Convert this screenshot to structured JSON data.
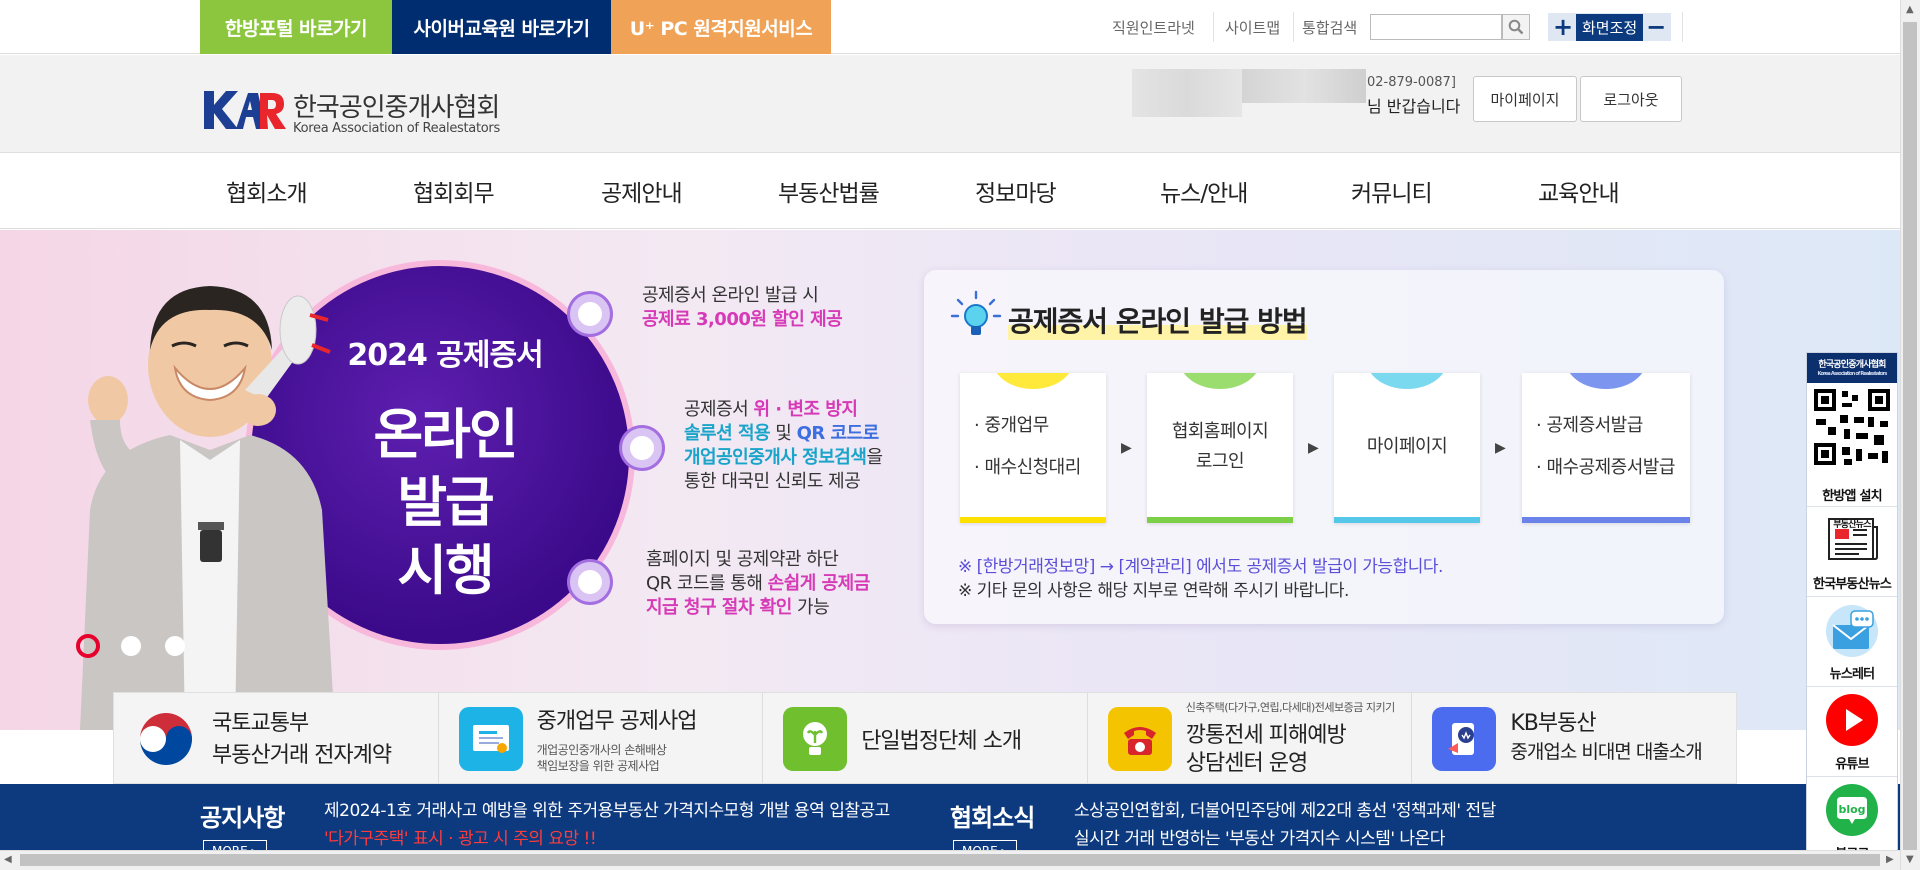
{
  "topbar": {
    "quick_links": [
      "한방포털 바로가기",
      "사이버교육원 바로가기",
      "U⁺ PC 원격지원서비스"
    ],
    "util_links": [
      "직원인트라넷",
      "사이트맵",
      "통합검색"
    ],
    "zoom_label": "화면조정",
    "zoom_in": "+",
    "zoom_out": "−"
  },
  "header": {
    "logo_ko": "한국공인중개사협회",
    "logo_en": "Korea Association of Realestators",
    "user_phone": "02-879-0087]",
    "user_greeting": "님 반갑습니다",
    "mypage": "마이페이지",
    "logout": "로그아웃"
  },
  "nav": [
    "협회소개",
    "협회회무",
    "공제안내",
    "부동산법률",
    "정보마당",
    "뉴스/안내",
    "커뮤니티",
    "교육안내"
  ],
  "hero": {
    "circle_year": "2024 공제증서",
    "circle_lines": [
      "온라인",
      "발급",
      "시행"
    ],
    "point1": {
      "line1": "공제증서 온라인 발급 시",
      "line2": "공제료 3,000원 할인 제공"
    },
    "point2": {
      "l1a": "공제증서 ",
      "l1b": "위 · 변조 방지",
      "l2a": "솔루션 적용",
      "l2b": " 및 ",
      "l2c": "QR 코드로",
      "l3a": "개업공인중개사 정보검색",
      "l3b": "을",
      "l4": "통한 대국민 신뢰도 제공"
    },
    "point3": {
      "l1": "홈페이지 및 공제약관 하단",
      "l2a": "QR 코드를 통해 ",
      "l2b": "손쉽게 공제금",
      "l3a": "지급 청구 절차 확인",
      "l3b": " 가능"
    },
    "panel_title": "공제증서 온라인 발급 방법",
    "steps": [
      {
        "lines": [
          "· 중개업무",
          "· 매수신청대리"
        ],
        "color": "#ffe93a",
        "bar": "#ffe000"
      },
      {
        "lines": [
          "협회홈페이지",
          "로그인"
        ],
        "color": "#9bdd6f",
        "bar": "#7ccf47"
      },
      {
        "lines": [
          "마이페이지"
        ],
        "color": "#7ad8ef",
        "bar": "#55c8ea"
      },
      {
        "lines": [
          "· 공제증서발급",
          "· 매수공제증서발급"
        ],
        "color": "#7c95ee",
        "bar": "#6b82e8"
      }
    ],
    "arrow": "▶",
    "note1": "※ [한방거래정보망] → [계약관리] 에서도 공제증서 발급이 가능합니다.",
    "note2": "※ 기타 문의 사항은 해당 지부로 연락해 주시기 바랍니다."
  },
  "quick_banners": [
    {
      "t1": "국토교통부",
      "t2": "부동산거래 전자계약"
    },
    {
      "t1": "중개업무 공제사업",
      "s1": "개업공인중개사의 손해배상",
      "s2": "책임보장을 위한 공제사업"
    },
    {
      "t1": "단일법정단체 소개"
    },
    {
      "small": "신축주택(다가구,연립,다세대)전세보증금 지키기",
      "t1": "깡통전세 피해예방",
      "t2": "상담센터 운영"
    },
    {
      "t1": "KB부동산",
      "t2": "중개업소 비대면 대출소개"
    }
  ],
  "news": {
    "notice_head": "공지사항",
    "notice_more": "MORE ▸",
    "notice1": "제2024-1호 거래사고 예방을 위한 주거용부동산 가격지수모형 개발 용역 입찰공고",
    "notice2": "'다가구주택' 표시 · 광고 시 주의 요망 !!",
    "assoc_head": "협회소식",
    "assoc_more": "MORE ▸",
    "assoc1": "소상공인연합회, 더불어민주당에 제22대 총선 '정책과제' 전달",
    "assoc2": "실시간 거래 반영하는 '부동산 가격지수 시스템' 나온다"
  },
  "sidebar": {
    "qr_top": "한국공인중개사협회",
    "qr_sub": "Korea Association of Realestators",
    "app": "한방앱 설치",
    "news_paper": "부동산뉴스",
    "news_label": "한국부동산뉴스",
    "letter": "뉴스레터",
    "youtube": "유튜브",
    "blog_icon": "blog",
    "blog": "블로그"
  }
}
